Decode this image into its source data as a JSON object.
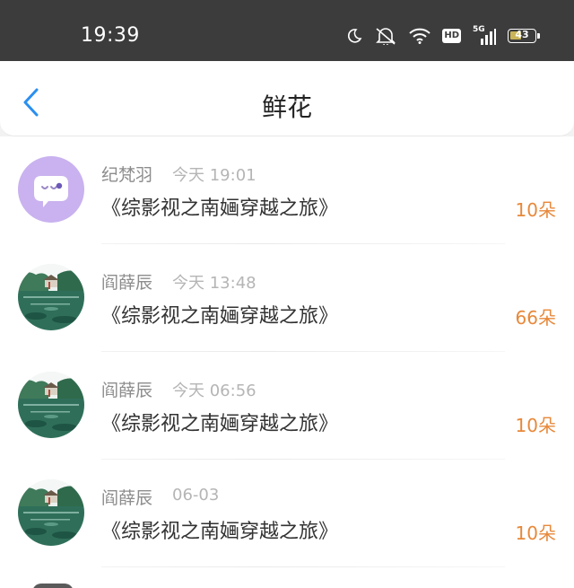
{
  "status_bar": {
    "time": "19:39",
    "icons": [
      "moon-icon",
      "mute-icon",
      "wifi-icon",
      "hd-icon",
      "5g-signal-icon",
      "battery-icon"
    ],
    "hd": "HD",
    "network": "5G",
    "battery": "43"
  },
  "header": {
    "back_icon": "chevron-left-icon",
    "title": "鲜花"
  },
  "items": [
    {
      "name": "纪梵羽",
      "time": "今天 19:01",
      "book": "《综影视之南婳穿越之旅》",
      "count": "10朵",
      "avatar": "default-purple"
    },
    {
      "name": "阎薛辰",
      "time": "今天 13:48",
      "book": "《综影视之南婳穿越之旅》",
      "count": "66朵",
      "avatar": "landscape"
    },
    {
      "name": "阎薛辰",
      "time": "今天 06:56",
      "book": "《综影视之南婳穿越之旅》",
      "count": "10朵",
      "avatar": "landscape"
    },
    {
      "name": "阎薛辰",
      "time": "06-03",
      "book": "《综影视之南婳穿越之旅》",
      "count": "10朵",
      "avatar": "landscape"
    }
  ],
  "colors": {
    "status_bar_bg": "#3c3c3c",
    "accent_blue": "#2a8ff0",
    "count_orange": "#e8883a",
    "avatar_purple": "#c9b2ef"
  }
}
